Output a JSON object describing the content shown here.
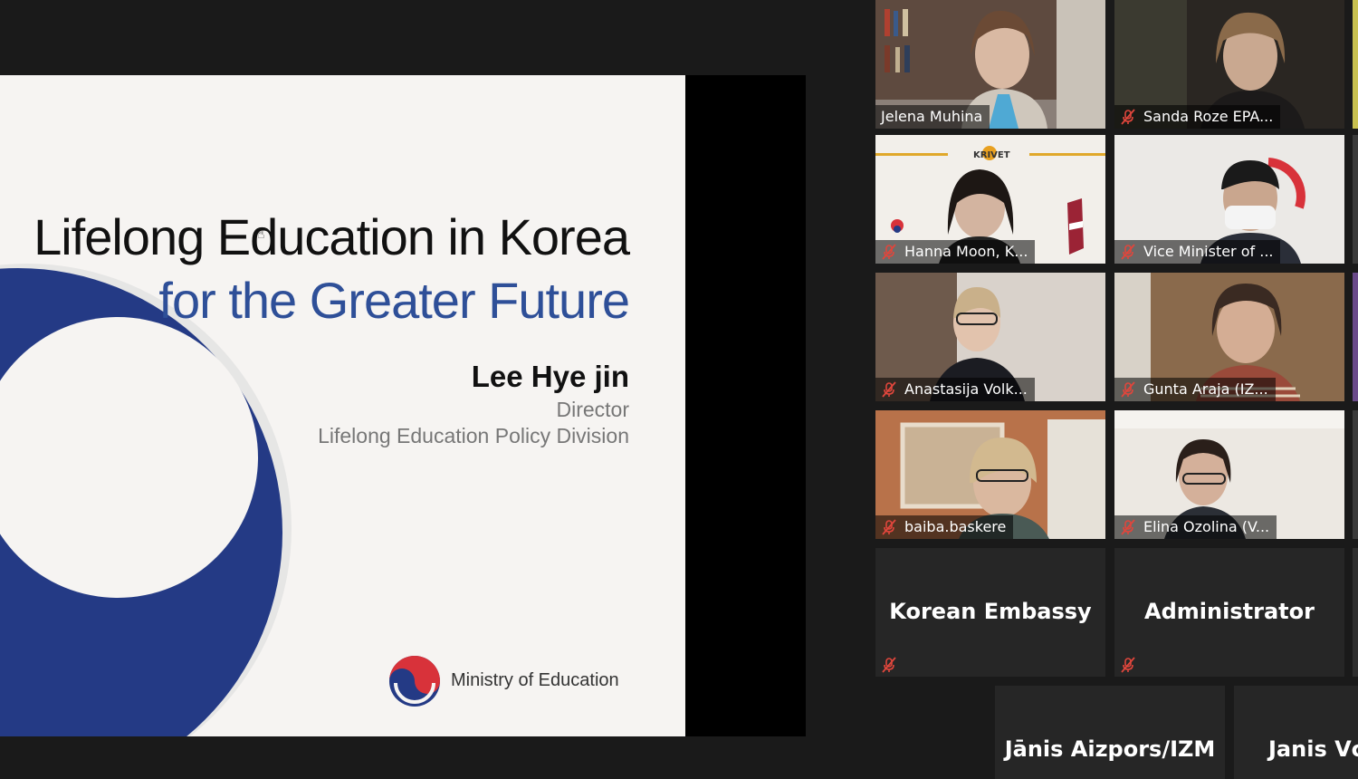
{
  "slide": {
    "title_line1": "Lifelong Education in Korea",
    "title_line2": "for the Greater Future",
    "presenter_name": "Lee Hye jin",
    "presenter_role": "Director",
    "presenter_division": "Lifelong Education Policy Division",
    "ministry": "Ministry of Education"
  },
  "participants": [
    {
      "name": "Jelena Muhina",
      "muted": false
    },
    {
      "name": "Sanda Roze EPA...",
      "muted": true
    },
    {
      "name": "Hanna Moon, K...",
      "muted": true
    },
    {
      "name": "Vice Minister of ...",
      "muted": true
    },
    {
      "name": "Anastasija Volk...",
      "muted": true
    },
    {
      "name": "Gunta Araja (IZ...",
      "muted": true
    },
    {
      "name": "baiba.baskere",
      "muted": true
    },
    {
      "name": "Elina Ozolina (V...",
      "muted": true
    },
    {
      "name": "Korean Embassy",
      "muted": true,
      "video": false
    },
    {
      "name": "Administrator",
      "muted": true,
      "video": false
    },
    {
      "name": "Jānis Aizpors/IZM",
      "muted": false,
      "video": false
    },
    {
      "name": "Janis Vc",
      "muted": false,
      "video": false
    }
  ],
  "colors": {
    "mute_icon": "#e0463c",
    "slide_blue": "#2e4f98",
    "tile_bg": "#262626"
  }
}
